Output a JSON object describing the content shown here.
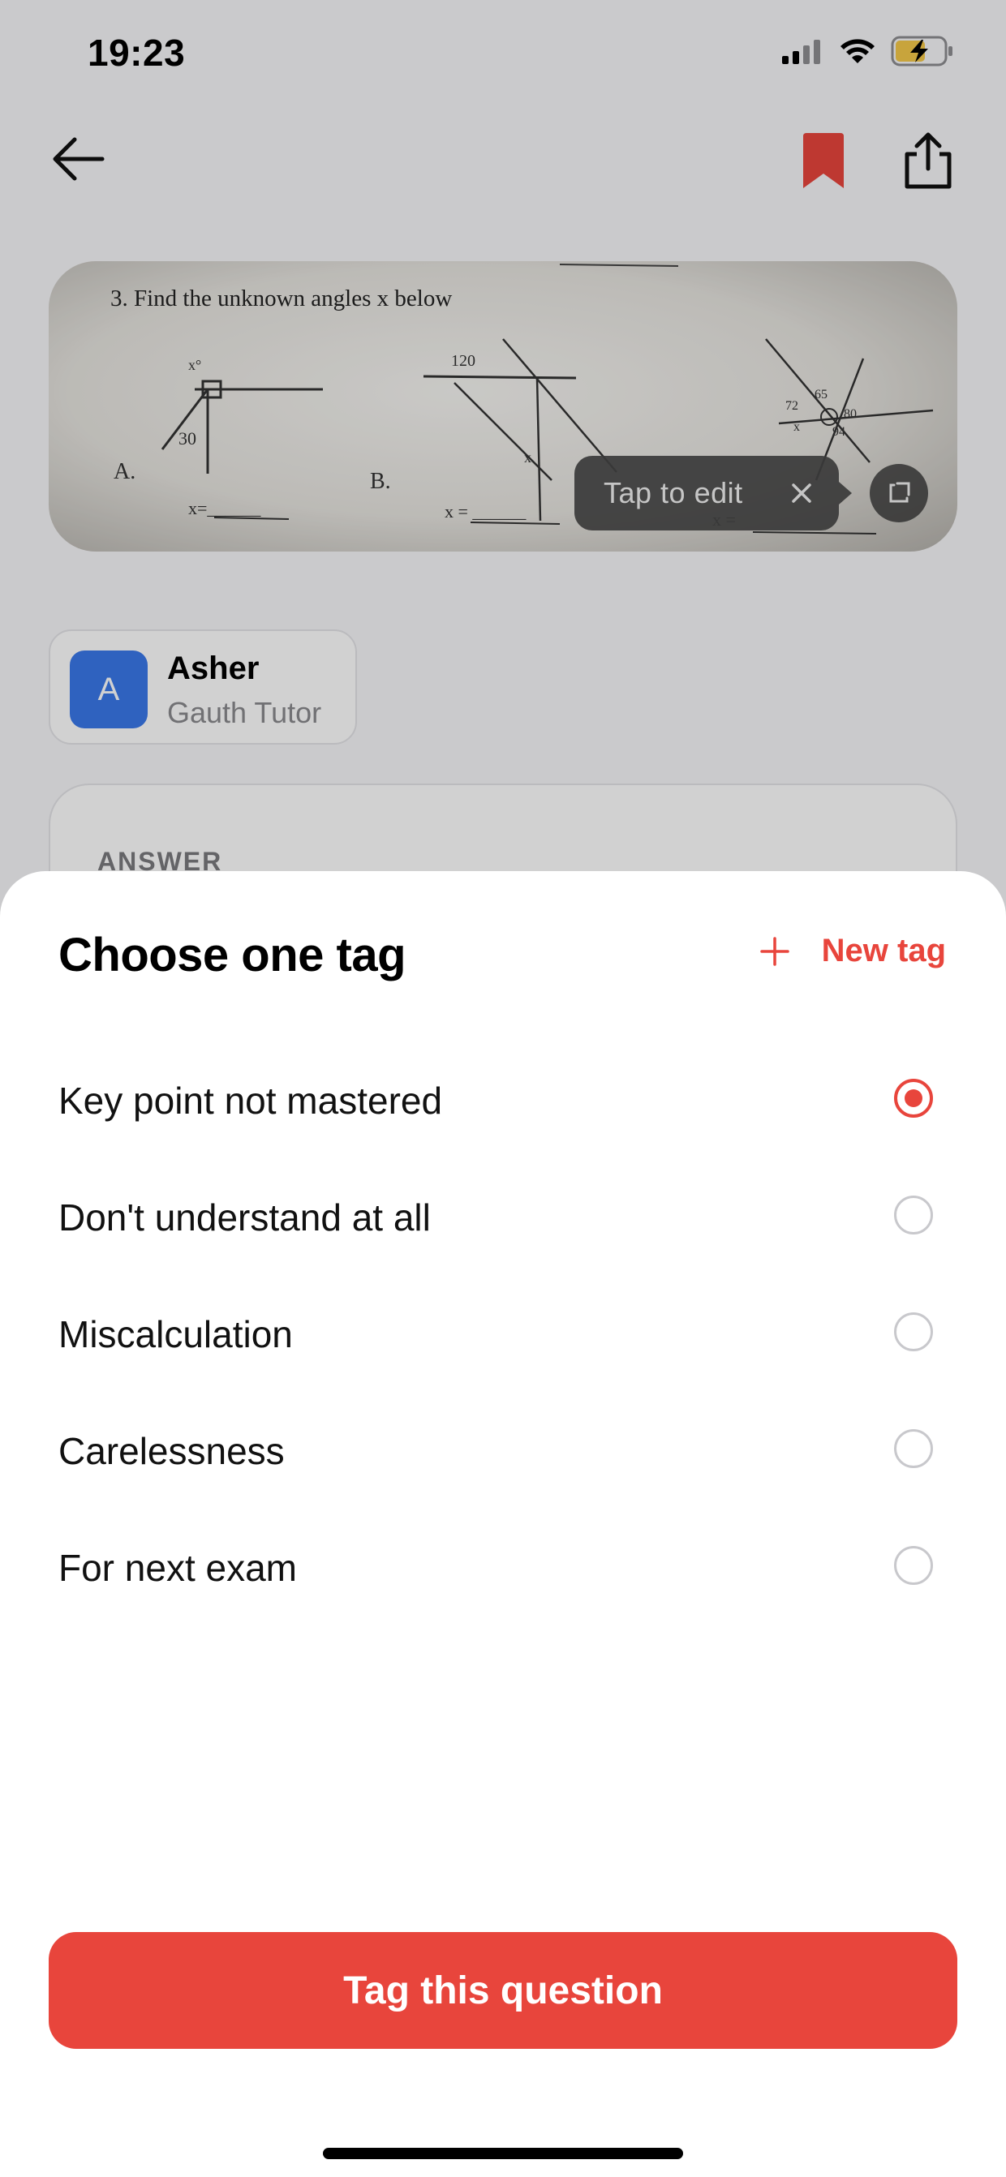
{
  "status_bar": {
    "time": "19:23",
    "icons": [
      "cellular-signal-icon",
      "wifi-icon",
      "battery-charging-icon"
    ]
  },
  "nav": {
    "icons": [
      "back-arrow-icon",
      "bookmark-icon",
      "share-icon"
    ],
    "bookmark_color": "#e8453c"
  },
  "question": {
    "title": "3. Find the unknown angles x  below",
    "parts": [
      "A.",
      "B."
    ],
    "blank_a": "x=______",
    "blank_b": "x = ______",
    "blank_c": "x =",
    "labels": {
      "a_x": "x°",
      "a_30": "30",
      "b_120": "120",
      "b_x": "x",
      "c_65": "65",
      "c_72": "72",
      "c_80": "80",
      "c_x": "x",
      "c_94": "94"
    },
    "tap_to_edit": "Tap to edit"
  },
  "tutor": {
    "initial": "A",
    "name": "Asher",
    "role": "Gauth Tutor",
    "avatar_color": "#3a78ea"
  },
  "answer": {
    "label": "ANSWER"
  },
  "sheet": {
    "title": "Choose one tag",
    "new_tag_label": "New tag",
    "tags": [
      {
        "label": "Key point not mastered",
        "selected": true
      },
      {
        "label": "Don't understand at all",
        "selected": false
      },
      {
        "label": "Miscalculation",
        "selected": false
      },
      {
        "label": "Carelessness",
        "selected": false
      },
      {
        "label": "For next exam",
        "selected": false
      }
    ],
    "submit_label": "Tag this question",
    "accent_color": "#e8453c"
  }
}
